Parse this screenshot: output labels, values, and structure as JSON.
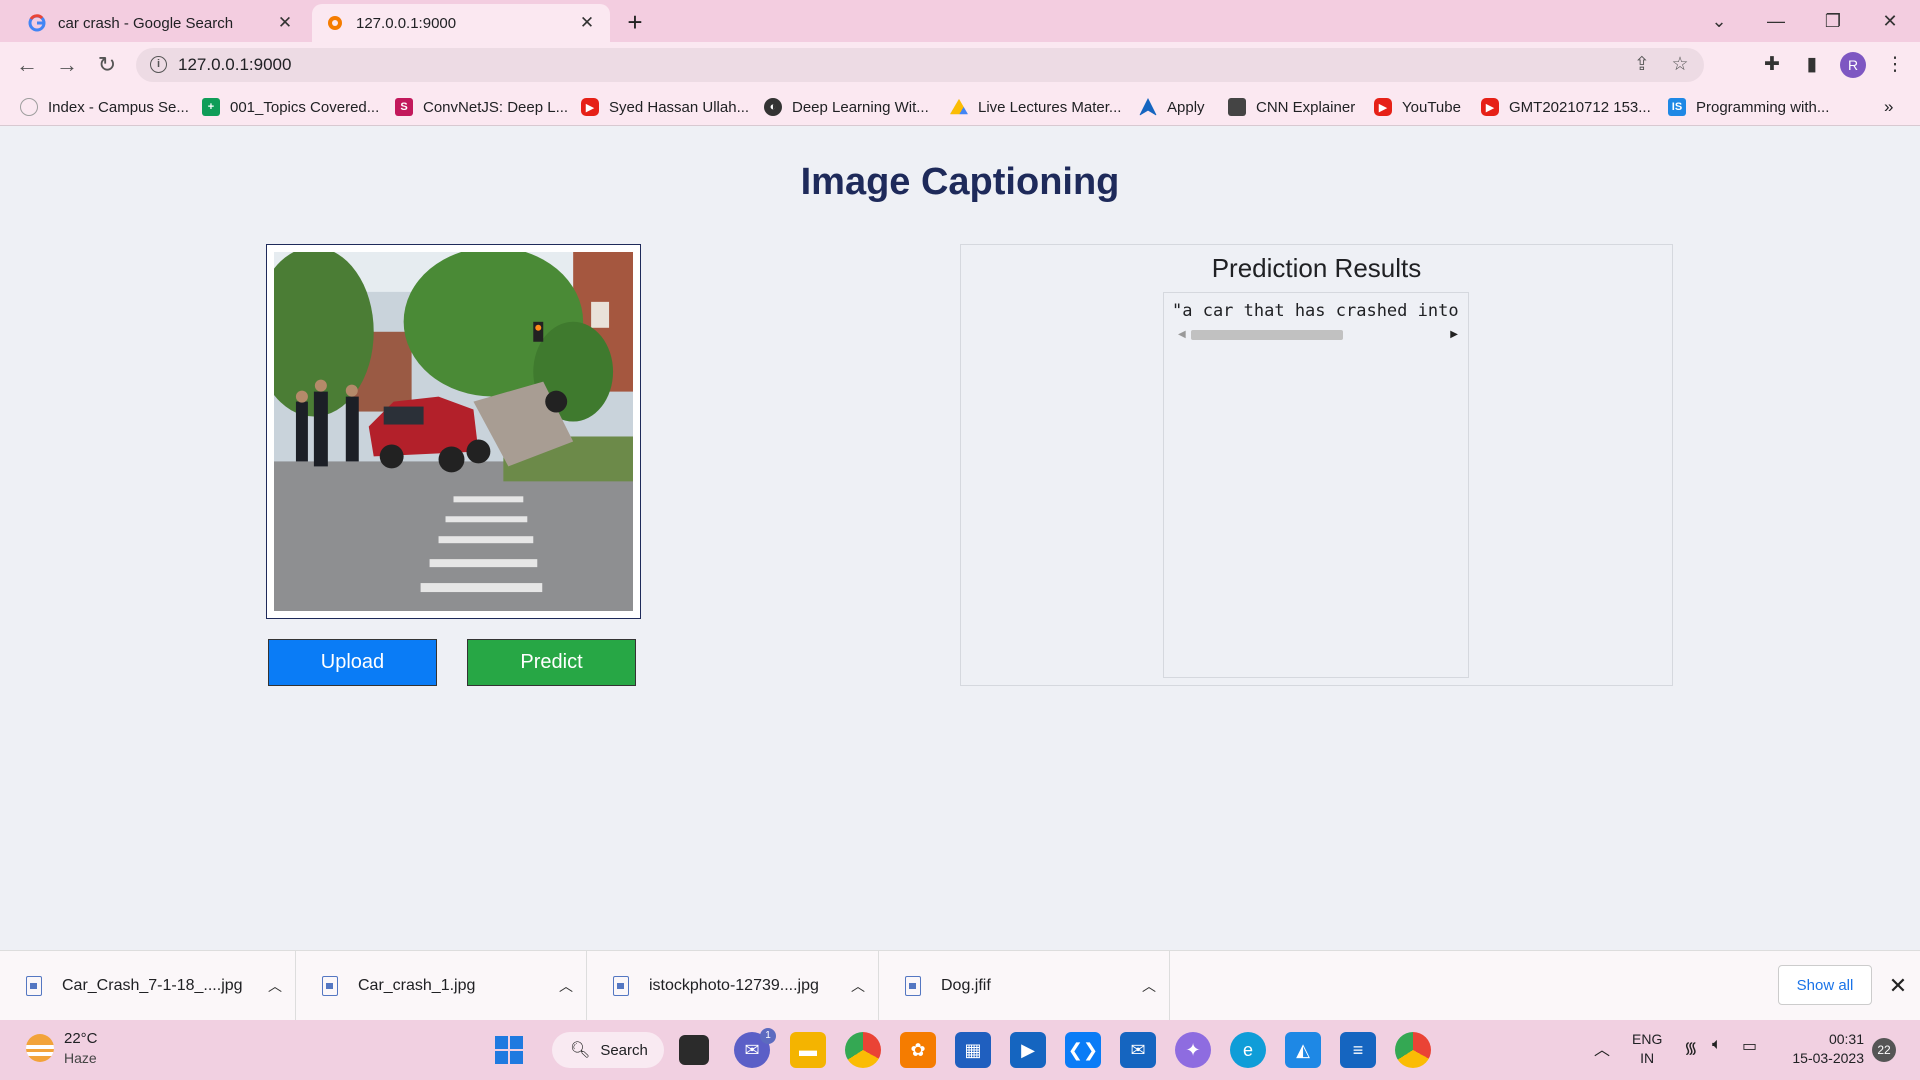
{
  "browser": {
    "tabs": [
      {
        "title": "car crash - Google Search",
        "active": false,
        "icon": "google-icon"
      },
      {
        "title": "127.0.0.1:9000",
        "active": true,
        "icon": "local-server-icon"
      }
    ],
    "url": "127.0.0.1:9000",
    "profile_initial": "R",
    "bookmarks": [
      {
        "label": "Index - Campus Se...",
        "icon": "campus-icon",
        "color": "#9e9e9e"
      },
      {
        "label": "001_Topics Covered...",
        "icon": "sheets-icon",
        "color": "#0f9d58"
      },
      {
        "label": "ConvNetJS: Deep L...",
        "icon": "convnetjs-icon",
        "color": "#c2185b"
      },
      {
        "label": "Syed Hassan Ullah...",
        "icon": "youtube-icon",
        "color": "#e62117"
      },
      {
        "label": "Deep Learning Wit...",
        "icon": "globe-icon",
        "color": "#333333"
      },
      {
        "label": "Live Lectures Mater...",
        "icon": "drive-icon",
        "color": "#fbbc04"
      },
      {
        "label": "Apply",
        "icon": "apply-icon",
        "color": "#1565c0"
      },
      {
        "label": "CNN Explainer",
        "icon": "cnn-explainer-icon",
        "color": "#444444"
      },
      {
        "label": "YouTube",
        "icon": "youtube-icon",
        "color": "#e62117"
      },
      {
        "label": "GMT20210712 153...",
        "icon": "youtube-icon",
        "color": "#e62117"
      },
      {
        "label": "Programming with...",
        "icon": "is-icon",
        "color": "#1e88e5"
      }
    ]
  },
  "page": {
    "title": "Image Captioning",
    "upload_label": "Upload",
    "predict_label": "Predict",
    "results_title": "Prediction Results",
    "caption": "\"a car that has crashed into the side of a road\"",
    "colors": {
      "upload": "#0a7cf6",
      "predict": "#27a745",
      "title": "#1e2a5a"
    }
  },
  "downloads": {
    "items": [
      {
        "name": "Car_Crash_7-1-18_....jpg"
      },
      {
        "name": "Car_crash_1.jpg"
      },
      {
        "name": "istockphoto-12739....jpg"
      },
      {
        "name": "Dog.jfif"
      }
    ],
    "show_all": "Show all"
  },
  "taskbar": {
    "temperature": "22°C",
    "weather": "Haze",
    "search_label": "Search",
    "chat_badge": "1",
    "lang_line1": "ENG",
    "lang_line2": "IN",
    "time": "00:31",
    "date": "15-03-2023",
    "notifications": "22"
  }
}
